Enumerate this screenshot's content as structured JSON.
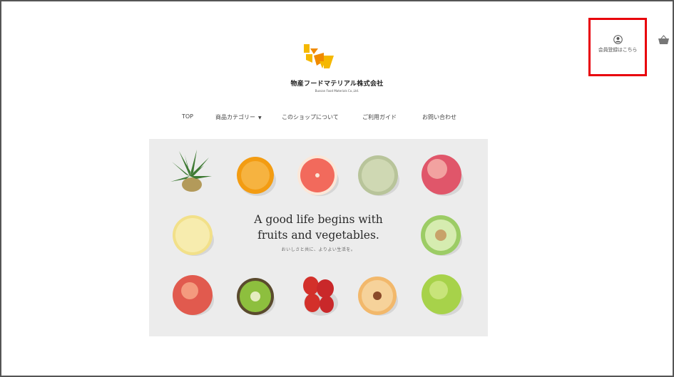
{
  "header": {
    "account_label": "会員登録はこちら",
    "company_name": "物産フードマテリアル株式会社",
    "company_name_en": "Bussan Food Materials Co.,Ltd."
  },
  "nav": {
    "items": [
      {
        "label": "TOP"
      },
      {
        "label": "商品カテゴリー"
      },
      {
        "label": "このショップについて"
      },
      {
        "label": "ご利用ガイド"
      },
      {
        "label": "お問い合わせ"
      }
    ]
  },
  "hero": {
    "title_line1": "A good life begins with",
    "title_line2": "fruits and vegetables.",
    "subtitle": "おいしさと共に、よりよい生活を。"
  },
  "icons": {
    "account": "user-circle-icon",
    "cart": "basket-icon",
    "dropdown": "caret-down-icon"
  },
  "colors": {
    "highlight_box": "#e8000b",
    "logo_yellow": "#f5b800",
    "logo_orange": "#f08a00",
    "hero_bg": "#ececec"
  }
}
